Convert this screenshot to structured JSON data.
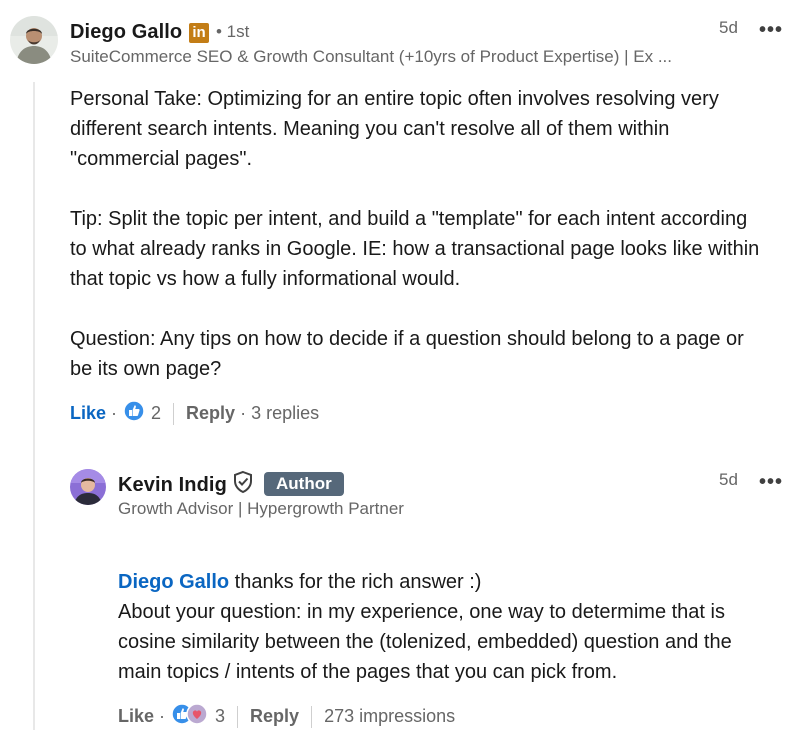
{
  "comment": {
    "author_name": "Diego Gallo",
    "linkedin_badge": "in",
    "degree": "• 1st",
    "headline": "SuiteCommerce SEO & Growth Consultant (+10yrs of Product Expertise) | Ex ...",
    "time": "5d",
    "more": "•••",
    "text": "Personal Take: Optimizing for an entire topic often involves resolving very\ndifferent search intents. Meaning you can't resolve all of them within\n\"commercial pages\".\n\nTip: Split the topic per intent, and build a \"template\" for each intent according\nto what already ranks in Google. IE: how a transactional page looks like within\nthat topic vs how a fully informational would.\n\nQuestion: Any tips on how to decide if a question should belong to a page or\nbe its own page?",
    "like_label": "Like",
    "dot": "·",
    "reaction_count": "2",
    "reply_label": "Reply",
    "replies_count": "· 3 replies",
    "like_color": "#0a66c2"
  },
  "reply": {
    "author_name": "Kevin Indig",
    "author_badge": "Author",
    "headline": "Growth Advisor | Hypergrowth Partner",
    "time": "5d",
    "more": "•••",
    "mention": "Diego Gallo",
    "text_after_mention": " thanks for the rich answer :)",
    "text_rest": "About your question: in my experience, one way to determime that is\ncosine similarity between the (tolenized, embedded) question and the\nmain topics / intents of the pages that you can pick from.",
    "like_label": "Like",
    "dot": "·",
    "reaction_count": "3",
    "reply_label": "Reply",
    "impressions": "273 impressions"
  },
  "icons": {
    "verified": "shield-check-icon",
    "like_reaction": "thumbs-up-icon",
    "support_reaction": "heart-hand-icon",
    "more": "ellipsis-icon"
  }
}
